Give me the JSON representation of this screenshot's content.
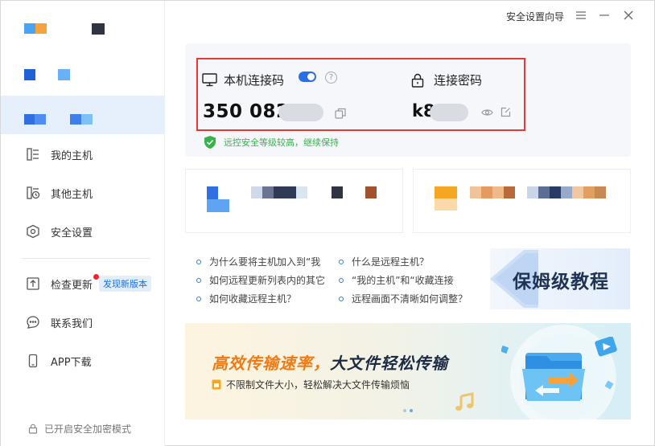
{
  "titlebar": {
    "security_guide": "安全设置向导"
  },
  "sidebar": {
    "items": [
      {
        "label": "我的主机",
        "icon": "host-list-icon"
      },
      {
        "label": "其他主机",
        "icon": "host-clock-icon"
      },
      {
        "label": "安全设置",
        "icon": "shield-hex-icon"
      },
      {
        "label": "检查更新",
        "icon": "upload-icon",
        "badge": "发现新版本"
      },
      {
        "label": "联系我们",
        "icon": "chat-icon"
      },
      {
        "label": "APP下载",
        "icon": "phone-icon"
      }
    ],
    "footer": "已开启安全加密模式"
  },
  "connection": {
    "code_label": "本机连接码",
    "code_value": "350 082",
    "toggle_on": true,
    "password_label": "连接密码",
    "password_value": "k8",
    "safety_tip": "远控安全等级较高，继续保持"
  },
  "tutorials": {
    "items": [
      "为什么要将主机加入到“我",
      "如何远程更新列表内的其它",
      "如何收藏远程主机？",
      "什么是远程主机？",
      "“我的主机”和“收藏连接",
      "远程画面不清晰如何调整？"
    ],
    "banner": "保姆级教程"
  },
  "promo": {
    "title_part1": "高效传输速率，",
    "title_part2": "大文件轻松传输",
    "subtitle": "不限制文件大小，轻松解决大文件传输烦恼"
  },
  "colors": {
    "accent": "#2a6fe8",
    "highlight_box": "#e53935",
    "safe_green": "#38b24a",
    "promo_orange": "#f07a14"
  }
}
